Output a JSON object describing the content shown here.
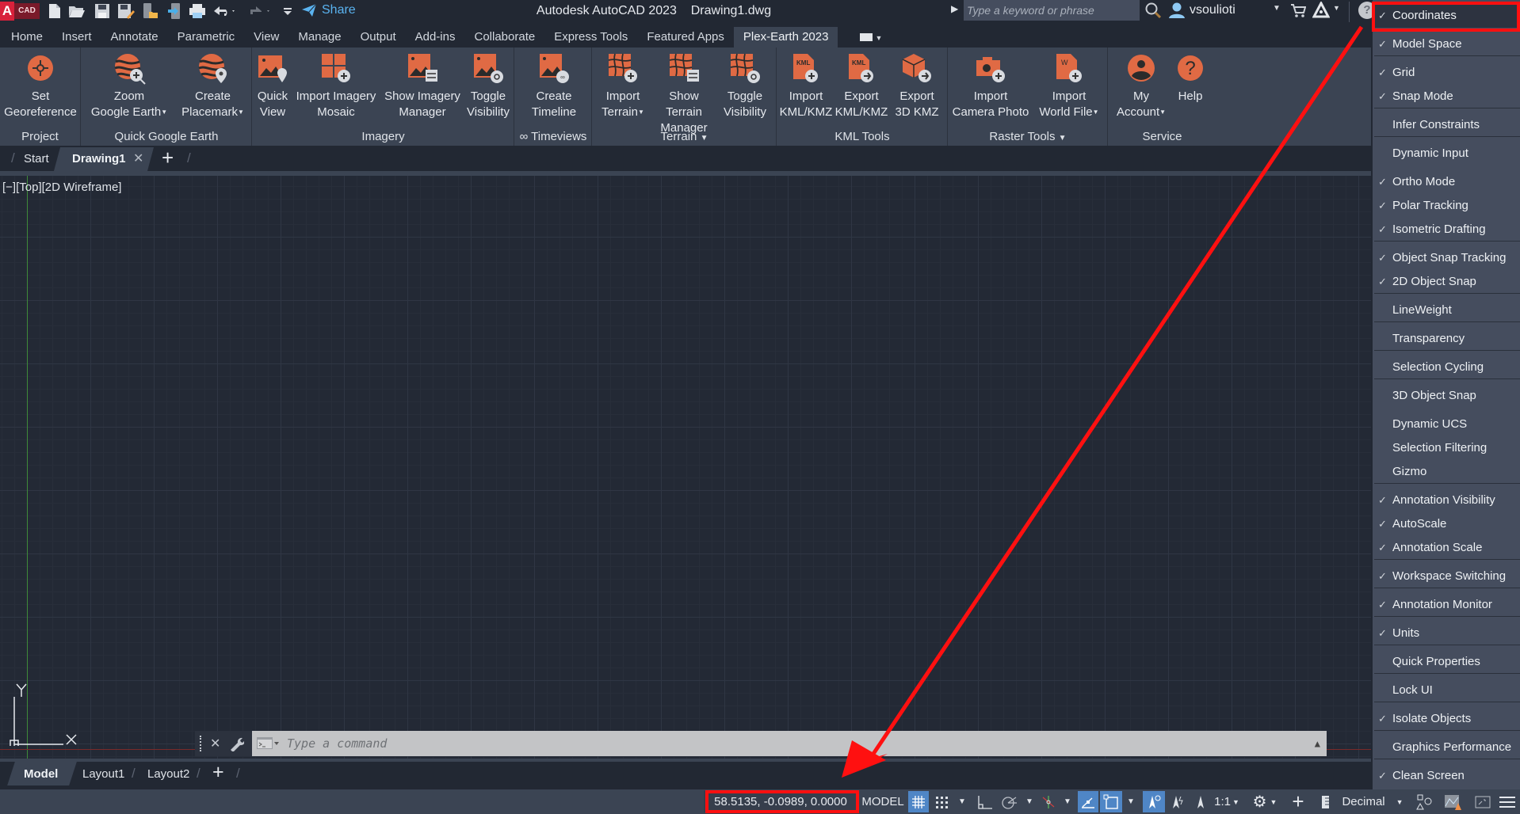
{
  "titlebar": {
    "logo_letter": "A",
    "logo_tag": "CAD",
    "app_title": "Autodesk AutoCAD 2023",
    "file_name": "Drawing1.dwg",
    "share_label": "Share",
    "search_placeholder": "Type a keyword or phrase",
    "username": "vsoulioti",
    "quick_access_icons": [
      "new-icon",
      "open-icon",
      "save-icon",
      "save-as-icon",
      "open-from-mobile-icon",
      "save-to-mobile-icon",
      "plot-icon",
      "undo-icon",
      "redo-icon",
      "customize-icon"
    ]
  },
  "ribbon_tabs": [
    {
      "label": "Home"
    },
    {
      "label": "Insert"
    },
    {
      "label": "Annotate"
    },
    {
      "label": "Parametric"
    },
    {
      "label": "View"
    },
    {
      "label": "Manage"
    },
    {
      "label": "Output"
    },
    {
      "label": "Add-ins"
    },
    {
      "label": "Collaborate"
    },
    {
      "label": "Express Tools"
    },
    {
      "label": "Featured Apps"
    },
    {
      "label": "Plex-Earth 2023",
      "active": true
    }
  ],
  "ribbon_panels": [
    {
      "title": "Project",
      "buttons": [
        {
          "line1": "Set",
          "line2": "Georeference"
        }
      ]
    },
    {
      "title": "Quick Google Earth",
      "buttons": [
        {
          "line1": "Zoom",
          "line2": "Google Earth"
        },
        {
          "line1": "Create",
          "line2": "Placemark"
        }
      ]
    },
    {
      "title": "Imagery",
      "buttons": [
        {
          "line1": "Quick",
          "line2": "View"
        },
        {
          "line1": "Import Imagery",
          "line2": "Mosaic"
        },
        {
          "line1": "Show Imagery",
          "line2": "Manager"
        },
        {
          "line1": "Toggle",
          "line2": "Visibility"
        }
      ]
    },
    {
      "title": "∞ Timeviews",
      "buttons": [
        {
          "line1": "Create",
          "line2": "Timeline"
        }
      ]
    },
    {
      "title": "Terrain",
      "buttons": [
        {
          "line1": "Import",
          "line2": "Terrain"
        },
        {
          "line1": "Show Terrain",
          "line2": "Manager"
        },
        {
          "line1": "Toggle",
          "line2": "Visibility"
        }
      ]
    },
    {
      "title": "KML Tools",
      "buttons": [
        {
          "line1": "Import",
          "line2": "KML/KMZ"
        },
        {
          "line1": "Export",
          "line2": "KML/KMZ"
        },
        {
          "line1": "Export",
          "line2": "3D KMZ"
        }
      ]
    },
    {
      "title": "Raster Tools",
      "buttons": [
        {
          "line1": "Import",
          "line2": "Camera Photo"
        },
        {
          "line1": "Import",
          "line2": "World File"
        }
      ]
    },
    {
      "title": "Service",
      "buttons": [
        {
          "line1": "My",
          "line2": "Account"
        },
        {
          "line1": "Help",
          "line2": ""
        }
      ]
    }
  ],
  "doc_tabs": [
    {
      "label": "Start"
    },
    {
      "label": "Drawing1",
      "active": true
    }
  ],
  "viewport": {
    "label": "[−][Top][2D Wireframe]",
    "ucs_x": "X",
    "ucs_y": "Y"
  },
  "command_line": {
    "placeholder": "Type a command"
  },
  "layout_tabs": [
    {
      "label": "Model",
      "active": true
    },
    {
      "label": "Layout1"
    },
    {
      "label": "Layout2"
    }
  ],
  "statusbar": {
    "coordinates": "58.5135, -0.0989, 0.0000",
    "model_label": "MODEL",
    "annotation_scale": "1:1",
    "units": "Decimal"
  },
  "status_menu": {
    "items": [
      {
        "label": "Coordinates",
        "checked": true
      },
      {
        "label": "Model Space",
        "checked": true
      },
      {
        "label": "Grid",
        "checked": true
      },
      {
        "label": "Snap Mode",
        "checked": true
      },
      {
        "label": "Infer Constraints",
        "checked": false
      },
      {
        "label": "Dynamic Input",
        "checked": false
      },
      {
        "label": "Ortho Mode",
        "checked": true
      },
      {
        "label": "Polar Tracking",
        "checked": true
      },
      {
        "label": "Isometric Drafting",
        "checked": true
      },
      {
        "label": "Object Snap Tracking",
        "checked": true
      },
      {
        "label": "2D Object Snap",
        "checked": true
      },
      {
        "label": "LineWeight",
        "checked": false
      },
      {
        "label": "Transparency",
        "checked": false
      },
      {
        "label": "Selection Cycling",
        "checked": false
      },
      {
        "label": "3D Object Snap",
        "checked": false
      },
      {
        "label": "Dynamic UCS",
        "checked": false
      },
      {
        "label": "Selection Filtering",
        "checked": false
      },
      {
        "label": "Gizmo",
        "checked": false
      },
      {
        "label": "Annotation Visibility",
        "checked": true
      },
      {
        "label": "AutoScale",
        "checked": true
      },
      {
        "label": "Annotation Scale",
        "checked": true
      },
      {
        "label": "Workspace Switching",
        "checked": true
      },
      {
        "label": "Annotation Monitor",
        "checked": true
      },
      {
        "label": "Units",
        "checked": true
      },
      {
        "label": "Quick Properties",
        "checked": false
      },
      {
        "label": "Lock UI",
        "checked": false
      },
      {
        "label": "Isolate Objects",
        "checked": true
      },
      {
        "label": "Graphics Performance",
        "checked": false
      },
      {
        "label": "Clean Screen",
        "checked": true
      }
    ],
    "check_glyph": "✓"
  },
  "colors": {
    "accent_orange": "#e06a44",
    "highlight_red": "#ff1010",
    "active_blue": "#4f86c6"
  }
}
